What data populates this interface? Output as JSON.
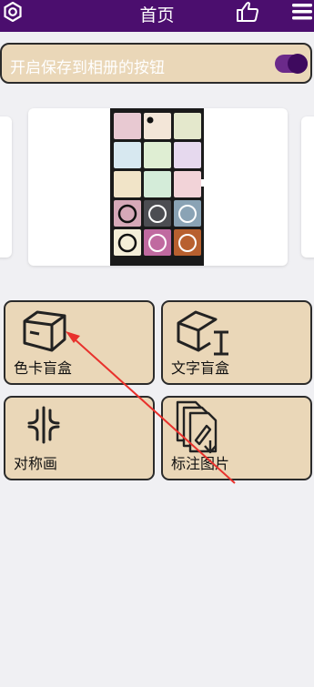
{
  "header": {
    "title": "首页",
    "settings_icon": "gear-icon",
    "like_icon": "thumbs-up-icon",
    "menu_icon": "hamburger-menu-icon"
  },
  "save_toggle": {
    "label": "开启保存到相册的按钮",
    "enabled": true
  },
  "tiles": [
    {
      "label": "色卡盲盒",
      "icon": "box-icon"
    },
    {
      "label": "文字盲盒",
      "icon": "text-box-icon"
    },
    {
      "label": "对称画",
      "icon": "symmetry-icon"
    },
    {
      "label": "标注图片",
      "icon": "annotate-image-icon"
    }
  ],
  "colors": {
    "header_bg": "#4b0e6e",
    "tile_bg": "#ead7b8",
    "page_bg": "#f0f0f3",
    "arrow": "#e8312c"
  }
}
